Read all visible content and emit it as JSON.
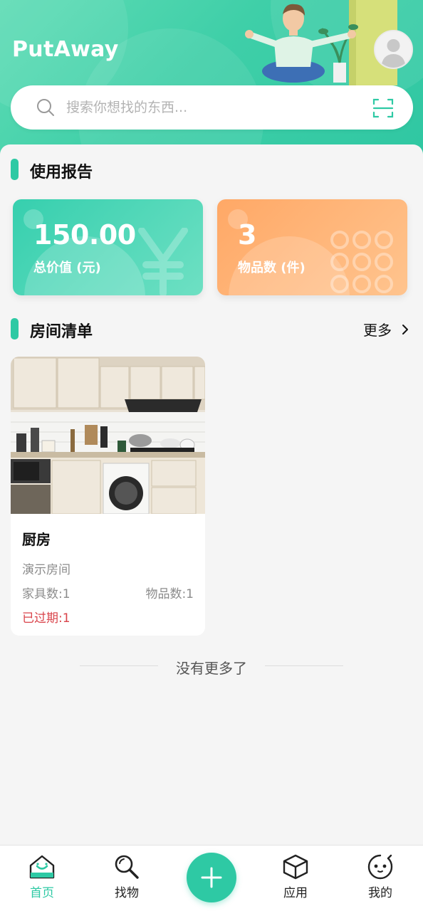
{
  "app": {
    "title": "PutAway"
  },
  "search": {
    "placeholder": "搜索你想找的东西..."
  },
  "usage_report": {
    "title": "使用报告",
    "total_value": {
      "value": "150.00",
      "label": "总价值 (元)"
    },
    "item_count": {
      "value": "3",
      "label": "物品数 (件)"
    }
  },
  "room_list": {
    "title": "房间清单",
    "more_label": "更多",
    "rooms": [
      {
        "name": "厨房",
        "description": "演示房间",
        "furniture_count": "家具数:1",
        "item_count": "物品数:1",
        "expired": "已过期:1"
      }
    ],
    "end_text": "没有更多了"
  },
  "tabbar": {
    "items": [
      {
        "label": "首页",
        "icon": "home-icon",
        "active": true
      },
      {
        "label": "找物",
        "icon": "search-icon",
        "active": false
      },
      {
        "label": "",
        "icon": "plus-icon",
        "active": false
      },
      {
        "label": "应用",
        "icon": "cube-icon",
        "active": false
      },
      {
        "label": "我的",
        "icon": "face-icon",
        "active": false
      }
    ]
  },
  "colors": {
    "accent": "#2ec9a4",
    "value_card": "#36cfae",
    "count_card": "#ffa866",
    "expired": "#d9434a"
  }
}
